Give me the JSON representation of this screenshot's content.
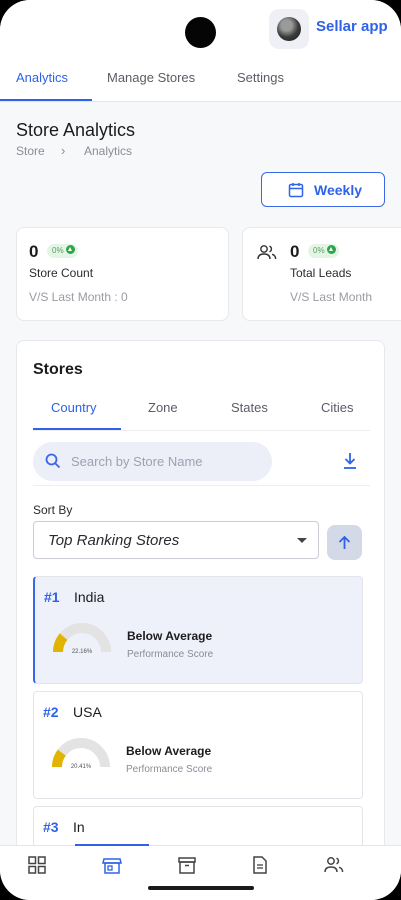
{
  "header": {
    "app_name": "Sellar app"
  },
  "tabs": [
    {
      "label": "Analytics",
      "active": true
    },
    {
      "label": "Manage Stores",
      "active": false
    },
    {
      "label": "Settings",
      "active": false
    }
  ],
  "page": {
    "title": "Store Analytics",
    "breadcrumb": [
      "Store",
      "Analytics"
    ]
  },
  "period_button": {
    "label": "Weekly",
    "icon": "calendar-icon"
  },
  "stats": [
    {
      "value": "0",
      "change": "0%",
      "label": "Store Count",
      "comparison": "V/S Last Month : 0"
    },
    {
      "value": "0",
      "change": "0%",
      "label": "Total Leads",
      "comparison": "V/S Last Month",
      "icon": "people-icon"
    }
  ],
  "stores": {
    "title": "Stores",
    "tabs": [
      {
        "label": "Country",
        "active": true
      },
      {
        "label": "Zone",
        "active": false
      },
      {
        "label": "States",
        "active": false
      },
      {
        "label": "Cities",
        "active": false
      }
    ],
    "search_placeholder": "Search by Store Name",
    "sort_label": "Sort By",
    "sort_value": "Top Ranking Stores",
    "items": [
      {
        "rank": "#1",
        "name": "India",
        "score_text": "22.16%",
        "score": 22.16,
        "status": "Below Average",
        "subtitle": "Performance Score",
        "selected": true
      },
      {
        "rank": "#2",
        "name": "USA",
        "score_text": "20.41%",
        "score": 20.41,
        "status": "Below Average",
        "subtitle": "Performance Score",
        "selected": false
      },
      {
        "rank": "#3",
        "name": "In",
        "selected": false
      }
    ]
  },
  "colors": {
    "accent": "#2f62e8",
    "gauge_fill": "#e0b400",
    "gauge_track": "#e3e3e3",
    "positive": "#2fa54a"
  },
  "bottom_nav": [
    {
      "icon": "dashboard-icon",
      "active": false
    },
    {
      "icon": "store-icon",
      "active": true
    },
    {
      "icon": "archive-icon",
      "active": false
    },
    {
      "icon": "document-icon",
      "active": false
    },
    {
      "icon": "people-icon",
      "active": false
    }
  ]
}
